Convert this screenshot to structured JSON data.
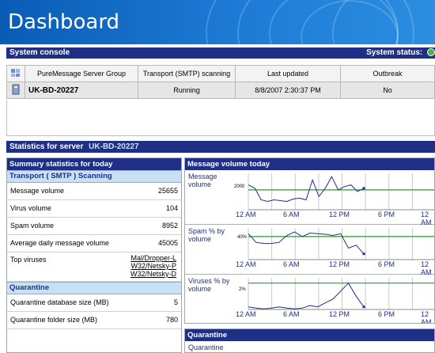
{
  "banner": {
    "title": "Dashboard"
  },
  "console": {
    "title": "System console",
    "status_label": "System status:",
    "headers": [
      "PureMessage Server Group",
      "Transport (SMTP) scanning",
      "Last updated",
      "Outbreak"
    ],
    "row": {
      "server": "UK-BD-20227",
      "status": "Running",
      "updated": "8/8/2007 2:30:37 PM",
      "outbreak": "No"
    }
  },
  "stats": {
    "title": "Statistics for server",
    "server": "UK-BD-20227"
  },
  "summary": {
    "title": "Summary statistics for today",
    "transport_head": "Transport ( SMTP ) Scanning",
    "rows": [
      {
        "label": "Message volume",
        "value": "25655"
      },
      {
        "label": "Virus volume",
        "value": "104"
      },
      {
        "label": "Spam volume",
        "value": "8952"
      },
      {
        "label": "Average daily message volume",
        "value": "45005"
      }
    ],
    "viruses_label": "Top viruses",
    "viruses": [
      "Mal/Dropper-L",
      "W32/Netsky-P",
      "W32/Netsky-D"
    ],
    "quarantine_head": "Quarantine",
    "quarantine_rows": [
      {
        "label": "Quarantine database size (MB)",
        "value": "5"
      },
      {
        "label": "Quarantine folder size (MB)",
        "value": "780"
      }
    ]
  },
  "charts": {
    "title": "Message volume today",
    "x_ticks": [
      "12 AM",
      "6 AM",
      "12 PM",
      "6 PM",
      "12 AM"
    ],
    "panels": [
      {
        "label": "Message volume",
        "ytick": "2000"
      },
      {
        "label": "Spam % by volume",
        "ytick": "40%"
      },
      {
        "label": "Viruses % by volume",
        "ytick": "2%"
      }
    ]
  },
  "chart_data": [
    {
      "type": "line",
      "title": "Message volume",
      "x": [
        "12 AM",
        "6 AM",
        "12 PM",
        "6 PM",
        "12 AM"
      ],
      "series": [
        {
          "values": [
            2300,
            2100,
            1400,
            1300,
            1400,
            1350,
            1300,
            1450,
            1500,
            1400,
            2600,
            1600,
            2100,
            2800,
            2000,
            2200,
            2300,
            1900,
            2100
          ]
        }
      ]
    },
    {
      "type": "line",
      "title": "Spam % by volume",
      "x": [
        "12 AM",
        "6 AM",
        "12 PM",
        "6 PM",
        "12 AM"
      ],
      "series": [
        {
          "values": [
            45,
            30,
            28,
            28,
            30,
            42,
            48,
            40,
            46,
            45,
            44,
            42,
            45,
            20,
            25,
            10
          ]
        }
      ]
    },
    {
      "type": "line",
      "title": "Viruses % by volume",
      "x": [
        "12 AM",
        "6 AM",
        "12 PM",
        "6 PM",
        "12 AM"
      ],
      "series": [
        {
          "values": [
            0.2,
            0.1,
            0.05,
            0.1,
            0.2,
            0.1,
            0.05,
            0.1,
            0.3,
            0.2,
            0.5,
            0.8,
            1.4,
            2.0,
            1.0,
            0.2
          ]
        }
      ]
    }
  ],
  "quarantine": {
    "title": "Quarantine",
    "sub": "Quarantine"
  },
  "colors": {
    "navy": "#1f2f86",
    "section": "#c8e0f2",
    "status_ok": "#3fbf3f",
    "series": "#1f2f86",
    "average": "#2a9a2a"
  }
}
